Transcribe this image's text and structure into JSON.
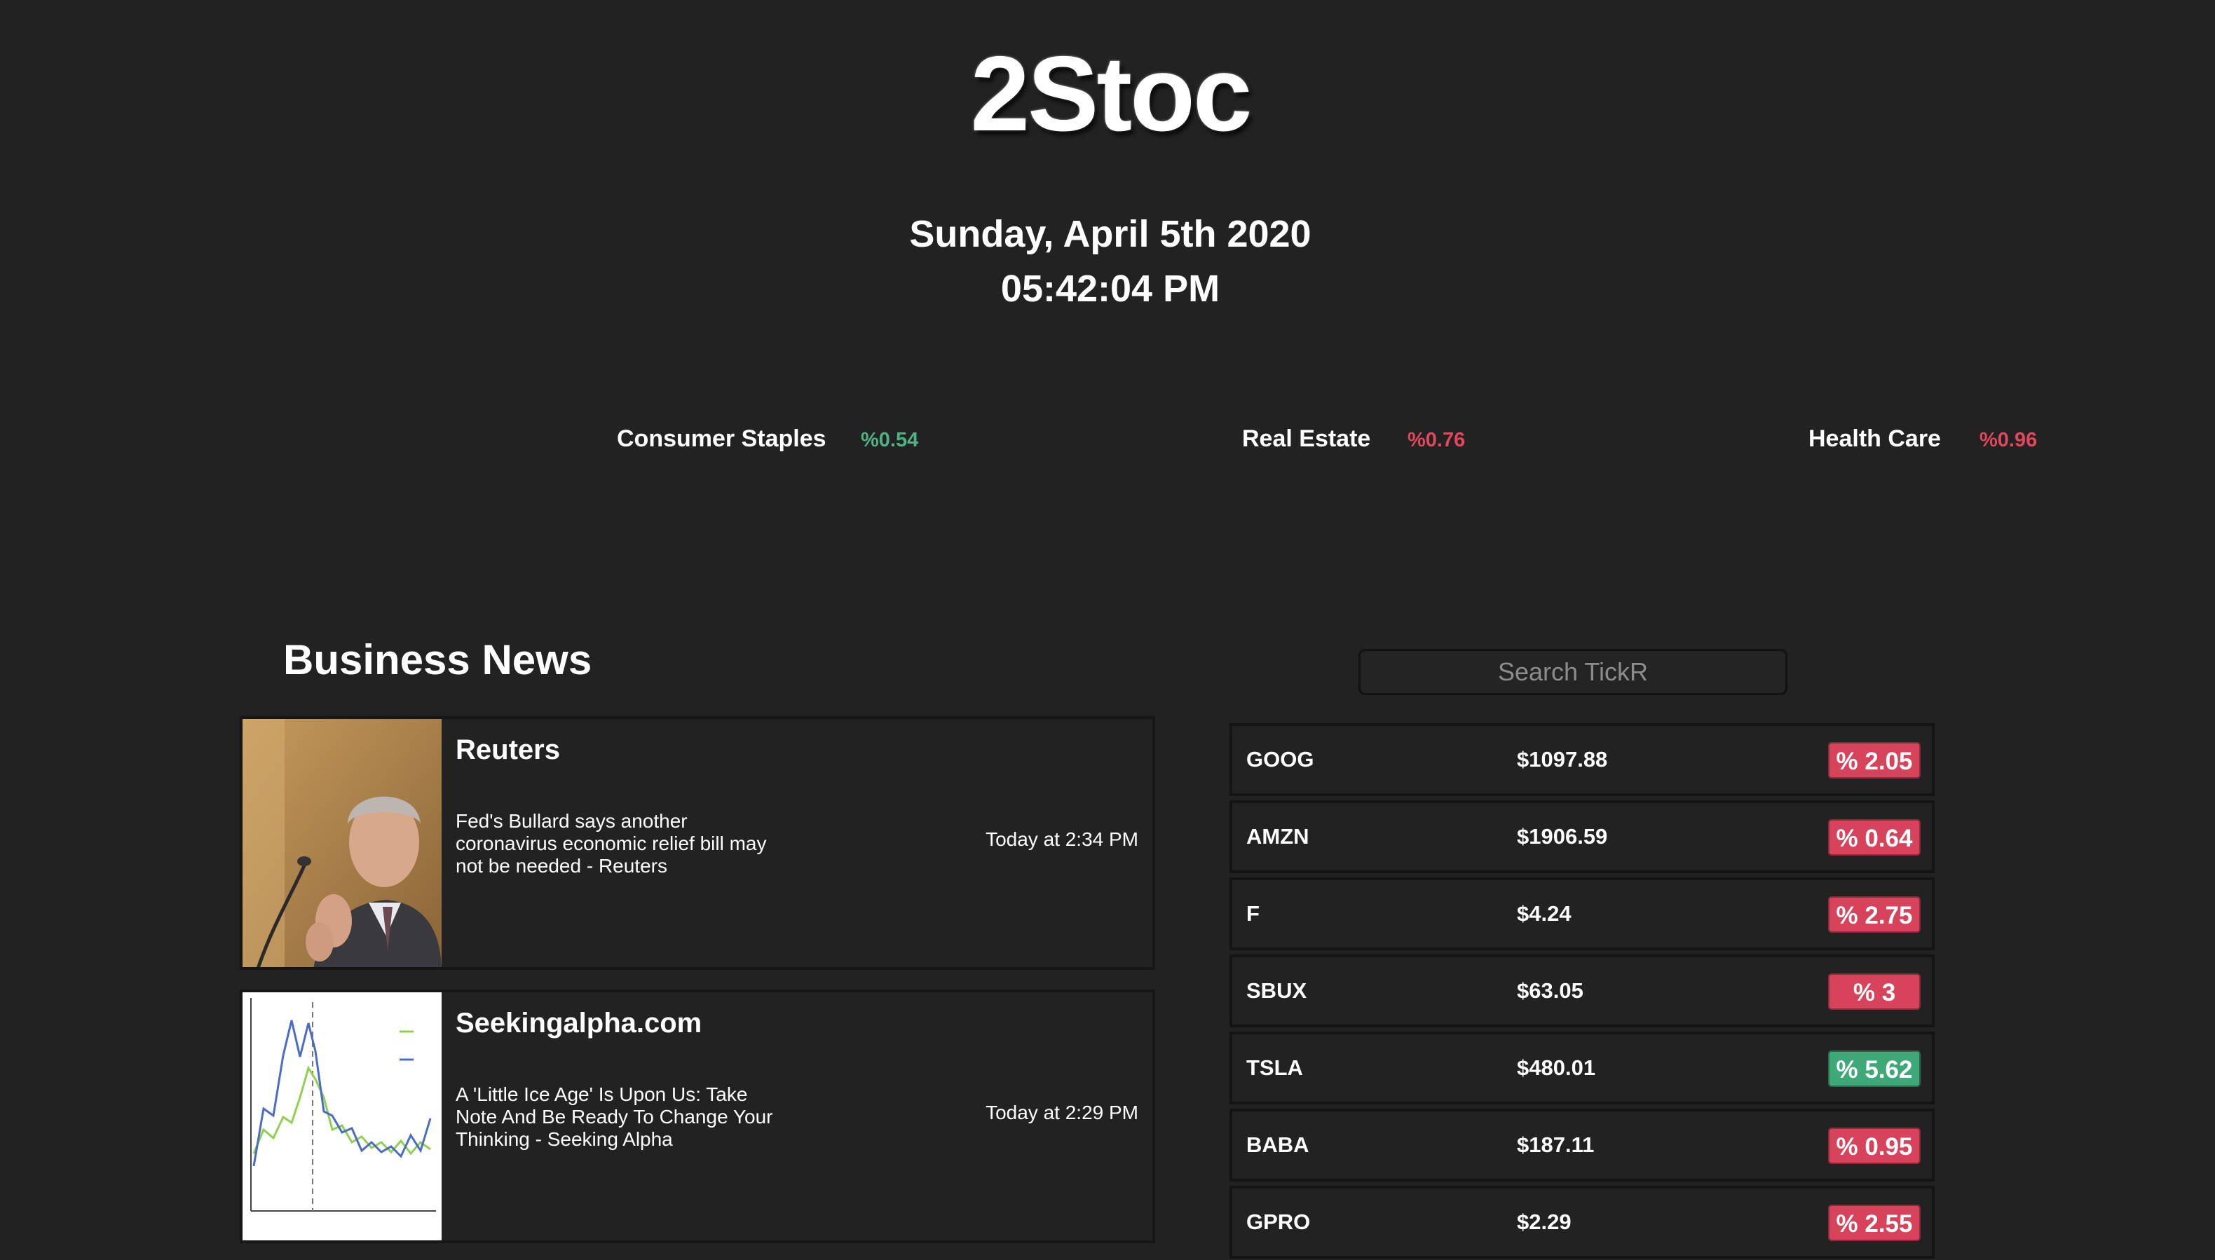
{
  "header": {
    "brand": "2Stoc",
    "date": "Sunday, April 5th 2020",
    "time": "05:42:04 PM"
  },
  "sectors": [
    {
      "name": "Consumer Staples",
      "change": "%0.54",
      "trend": "up"
    },
    {
      "name": "Real Estate",
      "change": "%0.76",
      "trend": "down"
    },
    {
      "name": "Health Care",
      "change": "%0.96",
      "trend": "down"
    }
  ],
  "news": {
    "heading": "Business News",
    "items": [
      {
        "source": "Reuters",
        "headline": "Fed's Bullard says another coronavirus economic relief bill may not be needed - Reuters",
        "time": "Today at 2:34 PM",
        "thumb_icon": "person-portrait-photo"
      },
      {
        "source": "Seekingalpha.com",
        "headline": "A 'Little Ice Age' Is Upon Us: Take Note And Be Ready To Change Your Thinking - Seeking Alpha",
        "time": "Today at 2:29 PM",
        "thumb_icon": "line-chart-thumbnail"
      }
    ]
  },
  "search": {
    "placeholder": "Search TickR"
  },
  "tickers": [
    {
      "symbol": "GOOG",
      "price": "$1097.88",
      "change": "% 2.05",
      "trend": "down"
    },
    {
      "symbol": "AMZN",
      "price": "$1906.59",
      "change": "% 0.64",
      "trend": "down"
    },
    {
      "symbol": "F",
      "price": "$4.24",
      "change": "% 2.75",
      "trend": "down"
    },
    {
      "symbol": "SBUX",
      "price": "$63.05",
      "change": "% 3",
      "trend": "down"
    },
    {
      "symbol": "TSLA",
      "price": "$480.01",
      "change": "% 5.62",
      "trend": "up"
    },
    {
      "symbol": "BABA",
      "price": "$187.11",
      "change": "% 0.95",
      "trend": "down"
    },
    {
      "symbol": "GPRO",
      "price": "$2.29",
      "change": "% 2.55",
      "trend": "down"
    }
  ],
  "colors": {
    "background": "#222222",
    "up": "#4fb384",
    "down": "#e0485d"
  }
}
